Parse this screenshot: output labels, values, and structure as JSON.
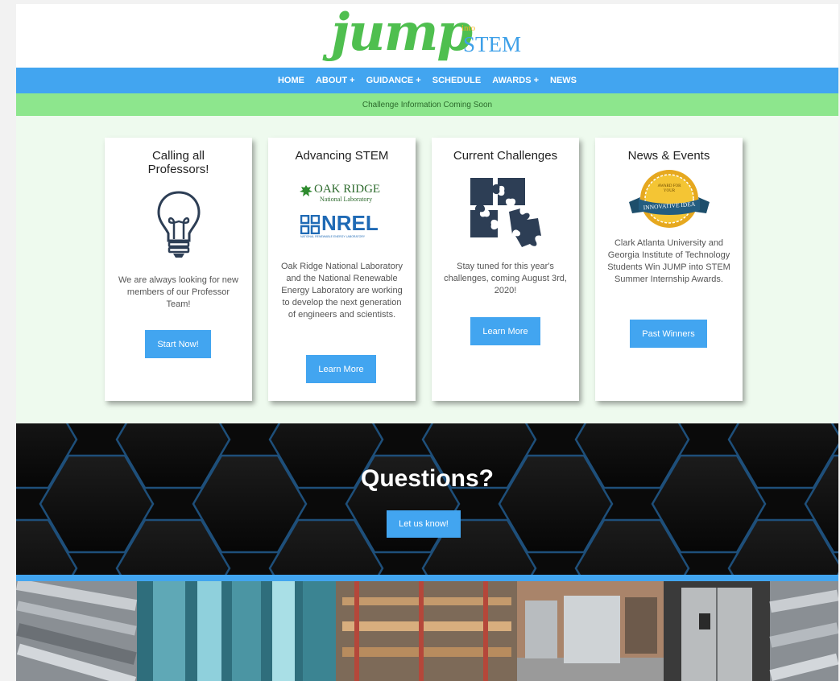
{
  "header": {
    "logo_jump": "jump",
    "logo_into": "into",
    "logo_stem": "STEM"
  },
  "nav": {
    "items": [
      "HOME",
      "ABOUT +",
      "GUIDANCE +",
      "SCHEDULE",
      "AWARDS +",
      "NEWS"
    ]
  },
  "announcement": "Challenge Information Coming Soon",
  "cards": [
    {
      "title": "Calling all Professors!",
      "icon": "lightbulb-icon",
      "text": "We are always looking for new members of our Professor Team!",
      "button": "Start Now!"
    },
    {
      "title": "Advancing STEM",
      "logo1": "OAK RIDGE",
      "logo1_sub": "National Laboratory",
      "logo2": "NREL",
      "logo2_sub": "NATIONAL RENEWABLE ENERGY LABORATORY",
      "text": "Oak Ridge National Laboratory and the National Renewable Energy Laboratory are working to develop the next generation of engineers and scientists.",
      "button": "Learn More"
    },
    {
      "title": "Current Challenges",
      "icon": "puzzle-icon",
      "text": "Stay tuned for this year's challenges, coming August 3rd, 2020!",
      "button": "Learn More"
    },
    {
      "title": "News & Events",
      "badge_top": "AWARD FOR YOUR",
      "badge_ribbon": "INNOVATIVE IDEA",
      "text": "Clark Atlanta University and Georgia Institute of Technology Students Win JUMP into STEM Summer Internship Awards.",
      "button": "Past Winners"
    }
  ],
  "questions": {
    "title": "Questions?",
    "button": "Let us know!"
  },
  "colors": {
    "nav_blue": "#42a5f0",
    "green_bar": "#8de68d",
    "page_bg": "#eefaee",
    "logo_green": "#4fbf4f"
  }
}
